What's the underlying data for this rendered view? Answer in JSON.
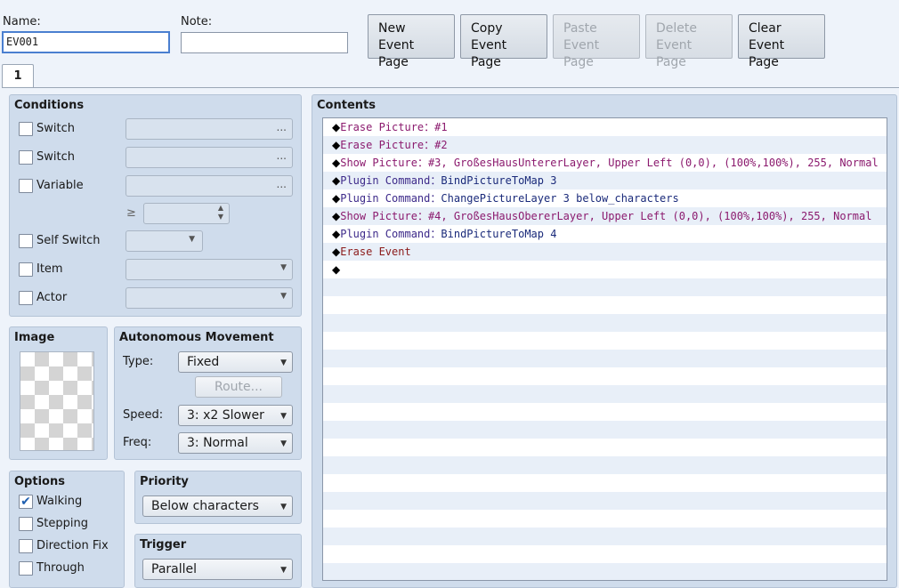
{
  "header": {
    "name_label": "Name:",
    "name_value": "EV001",
    "note_label": "Note:",
    "note_value": "",
    "buttons": {
      "new": "New\nEvent Page",
      "copy": "Copy\nEvent Page",
      "paste": "Paste\nEvent Page",
      "delete": "Delete\nEvent Page",
      "clear": "Clear\nEvent Page"
    }
  },
  "tab": {
    "label": "1"
  },
  "conditions": {
    "title": "Conditions",
    "switch1": "Switch",
    "switch2": "Switch",
    "variable": "Variable",
    "ge": "≥",
    "self_switch": "Self Switch",
    "item": "Item",
    "actor": "Actor",
    "ellipsis": "..."
  },
  "image": {
    "title": "Image"
  },
  "movement": {
    "title": "Autonomous Movement",
    "type_label": "Type:",
    "type_value": "Fixed",
    "route_label": "Route...",
    "speed_label": "Speed:",
    "speed_value": "3: x2 Slower",
    "freq_label": "Freq:",
    "freq_value": "3: Normal"
  },
  "options": {
    "title": "Options",
    "walking": "Walking",
    "walking_checked": true,
    "stepping": "Stepping",
    "direction_fix": "Direction Fix",
    "through": "Through"
  },
  "priority": {
    "title": "Priority",
    "value": "Below characters"
  },
  "trigger": {
    "title": "Trigger",
    "value": "Parallel"
  },
  "contents": {
    "title": "Contents",
    "commands": [
      {
        "name": "Erase Picture",
        "sep": "：",
        "args": "#1",
        "color": "#8b1a6e",
        "argcolor": "#8b1a6e"
      },
      {
        "name": "Erase Picture",
        "sep": "：",
        "args": "#2",
        "color": "#8b1a6e",
        "argcolor": "#8b1a6e"
      },
      {
        "name": "Show Picture",
        "sep": "：",
        "args": "#3, GroßesHausUntererLayer, Upper Left (0,0), (100%,100%), 255, Normal",
        "color": "#8b1a6e",
        "argcolor": "#8b1a6e"
      },
      {
        "name": "Plugin Command",
        "sep": "：",
        "args": "BindPictureToMap 3",
        "color": "#3d2a8a",
        "argcolor": "#1a2a7a"
      },
      {
        "name": "Plugin Command",
        "sep": "：",
        "args": "ChangePictureLayer 3 below_characters",
        "color": "#3d2a8a",
        "argcolor": "#1a2a7a"
      },
      {
        "name": "Show Picture",
        "sep": "：",
        "args": "#4, GroßesHausObererLayer, Upper Left (0,0), (100%,100%), 255, Normal",
        "color": "#8b1a6e",
        "argcolor": "#8b1a6e"
      },
      {
        "name": "Plugin Command",
        "sep": "：",
        "args": "BindPictureToMap 4",
        "color": "#3d2a8a",
        "argcolor": "#1a2a7a"
      },
      {
        "name": "Erase Event",
        "sep": "",
        "args": "",
        "color": "#8b1a1a",
        "argcolor": "#8b1a1a"
      },
      {
        "name": "",
        "sep": "",
        "args": "",
        "color": "#000",
        "argcolor": "#000"
      }
    ],
    "marker": "◆",
    "check": "✔"
  }
}
